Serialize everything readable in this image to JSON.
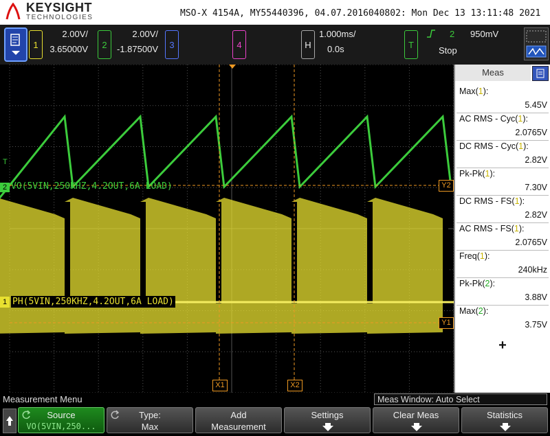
{
  "header": {
    "brand": "KEYSIGHT",
    "brand_sub": "TECHNOLOGIES",
    "device_info": "MSO-X 4154A, MY55440396, 04.07.2016040802: Mon Dec 13 13:11:48 2021"
  },
  "channels": {
    "ch1": {
      "number": "1",
      "scale": "2.00V/",
      "offset": "3.65000V",
      "color": "#e8e030"
    },
    "ch2": {
      "number": "2",
      "scale": "2.00V/",
      "offset": "-1.87500V",
      "color": "#3ccc3c"
    },
    "ch3": {
      "number": "3",
      "color": "#5577ff"
    },
    "ch4": {
      "number": "4",
      "color": "#ee44cc"
    }
  },
  "horizontal": {
    "label": "H",
    "scale": "1.000ms/",
    "delay": "0.0s"
  },
  "trigger": {
    "label": "T",
    "source": "2",
    "level": "950mV",
    "state": "Stop",
    "slope_icon": "rising-edge-icon"
  },
  "waveform_labels": {
    "ch2": "VO(5VIN,250KHZ,4.2OUT,6A LOAD)",
    "ch1": "PH(5VIN,250KHZ,4.2OUT,6A LOAD)"
  },
  "markers": {
    "ground_ch2": "2",
    "ground_ch1": "1",
    "trig_level": "T",
    "x1": "X1",
    "x2": "X2",
    "y1": "Y1",
    "y2": "Y2"
  },
  "meas": {
    "title": "Meas",
    "items": [
      {
        "name": "Max",
        "src": "1",
        "value": "5.45V"
      },
      {
        "name": "AC RMS - Cyc",
        "src": "1",
        "value": "2.0765V"
      },
      {
        "name": "DC RMS - Cyc",
        "src": "1",
        "value": "2.82V"
      },
      {
        "name": "Pk-Pk",
        "src": "1",
        "value": "7.30V"
      },
      {
        "name": "DC RMS - FS",
        "src": "1",
        "value": "2.82V"
      },
      {
        "name": "AC RMS - FS",
        "src": "1",
        "value": "2.0765V"
      },
      {
        "name": "Freq",
        "src": "1",
        "value": "240kHz"
      },
      {
        "name": "Pk-Pk",
        "src": "2",
        "value": "3.88V"
      },
      {
        "name": "Max",
        "src": "2",
        "value": "3.75V"
      }
    ],
    "add_symbol": "+"
  },
  "bottom": {
    "menu_title": "Measurement Menu",
    "meas_window": "Meas Window: Auto Select",
    "softkeys": {
      "source_l1": "Source",
      "source_l2": "VO(5VIN,250...",
      "type_l1": "Type:",
      "type_l2": "Max",
      "add_l1": "Add",
      "add_l2": "Measurement",
      "settings": "Settings",
      "clear": "Clear Meas",
      "statistics": "Statistics"
    }
  },
  "colors": {
    "ch1": "#e8e030",
    "ch2": "#3ccc3c",
    "cursor": "#ee9922",
    "grid": "#555555"
  }
}
